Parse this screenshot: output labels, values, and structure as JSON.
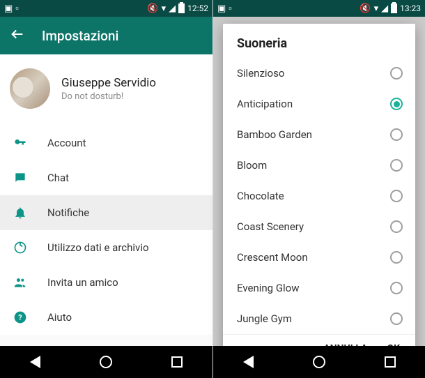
{
  "screen1": {
    "statusbar": {
      "time": "12:52"
    },
    "appbar": {
      "title": "Impostazioni"
    },
    "profile": {
      "name": "Giuseppe Servidio",
      "status": "Do not dosturb!"
    },
    "settings": [
      {
        "label": "Account",
        "icon": "key-icon",
        "active": false
      },
      {
        "label": "Chat",
        "icon": "chat-icon",
        "active": false
      },
      {
        "label": "Notifiche",
        "icon": "bell-icon",
        "active": true
      },
      {
        "label": "Utilizzo dati e archivio",
        "icon": "data-icon",
        "active": false
      },
      {
        "label": "Invita un amico",
        "icon": "invite-icon",
        "active": false
      },
      {
        "label": "Aiuto",
        "icon": "help-icon",
        "active": false
      }
    ]
  },
  "screen2": {
    "statusbar": {
      "time": "13:23"
    },
    "dialog": {
      "title": "Suoneria",
      "items": [
        {
          "label": "Silenzioso",
          "selected": false
        },
        {
          "label": "Anticipation",
          "selected": true
        },
        {
          "label": "Bamboo Garden",
          "selected": false
        },
        {
          "label": "Bloom",
          "selected": false
        },
        {
          "label": "Chocolate",
          "selected": false
        },
        {
          "label": "Coast Scenery",
          "selected": false
        },
        {
          "label": "Crescent Moon",
          "selected": false
        },
        {
          "label": "Evening Glow",
          "selected": false
        },
        {
          "label": "Jungle Gym",
          "selected": false
        }
      ],
      "cancel": "ANNULLA",
      "ok": "OK"
    }
  },
  "colors": {
    "accent": "#0d9488",
    "appbar": "#0d7468"
  }
}
